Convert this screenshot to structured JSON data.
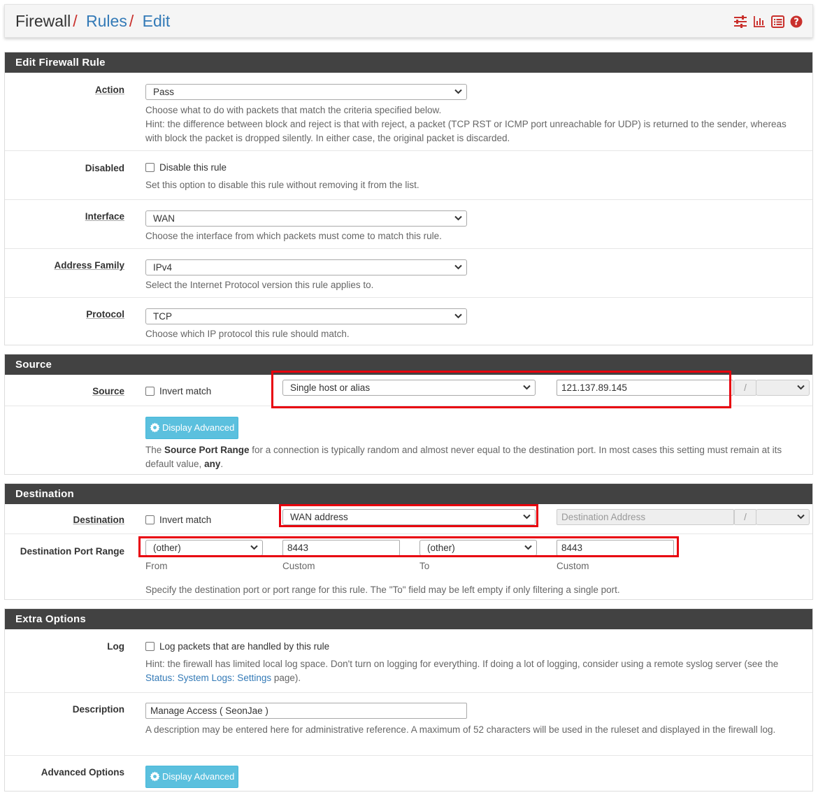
{
  "breadcrumb": {
    "firewall": "Firewall",
    "sep": "/",
    "rules": "Rules",
    "edit": "Edit"
  },
  "toolbar_icons": [
    "sliders-icon",
    "bar-chart-icon",
    "list-icon",
    "help-icon"
  ],
  "colors": {
    "accent_red": "#c9302c",
    "panel_head": "#424242",
    "link": "#337ab7",
    "info_button": "#5bc0de",
    "highlight": "#e8000d"
  },
  "edit_rule": {
    "title": "Edit Firewall Rule",
    "action": {
      "label": "Action",
      "value": "Pass",
      "help1": "Choose what to do with packets that match the criteria specified below.",
      "help2": "Hint: the difference between block and reject is that with reject, a packet (TCP RST or ICMP port unreachable for UDP) is returned to the sender, whereas with block the packet is dropped silently. In either case, the original packet is discarded."
    },
    "disabled": {
      "label": "Disabled",
      "checkbox_label": "Disable this rule",
      "help": "Set this option to disable this rule without removing it from the list."
    },
    "interface": {
      "label": "Interface",
      "value": "WAN",
      "help": "Choose the interface from which packets must come to match this rule."
    },
    "address_family": {
      "label": "Address Family",
      "value": "IPv4",
      "help": "Select the Internet Protocol version this rule applies to."
    },
    "protocol": {
      "label": "Protocol",
      "value": "TCP",
      "help": "Choose which IP protocol this rule should match."
    }
  },
  "source": {
    "title": "Source",
    "label": "Source",
    "invert_label": "Invert match",
    "type": "Single host or alias",
    "address": "121.137.89.145",
    "slash": "/",
    "advanced_button": "Display Advanced",
    "help_pre": "The ",
    "help_bold": "Source Port Range",
    "help_mid": " for a connection is typically random and almost never equal to the destination port. In most cases this setting must remain at its default value, ",
    "help_any": "any",
    "help_end": "."
  },
  "destination": {
    "title": "Destination",
    "label": "Destination",
    "invert_label": "Invert match",
    "type": "WAN address",
    "address_placeholder": "Destination Address",
    "slash": "/",
    "port_range": {
      "label": "Destination Port Range",
      "from_select": "(other)",
      "from_custom": "8443",
      "to_select": "(other)",
      "to_custom": "8443",
      "from_label": "From",
      "custom_label": "Custom",
      "to_label": "To",
      "help": "Specify the destination port or port range for this rule. The \"To\" field may be left empty if only filtering a single port."
    }
  },
  "extra": {
    "title": "Extra Options",
    "log": {
      "label": "Log",
      "checkbox_label": "Log packets that are handled by this rule",
      "help_pre": "Hint: the firewall has limited local log space. Don't turn on logging for everything. If doing a lot of logging, consider using a remote syslog server (see the ",
      "help_link": "Status: System Logs: Settings",
      "help_post": " page)."
    },
    "description": {
      "label": "Description",
      "value": "Manage Access ( SeonJae )",
      "help": "A description may be entered here for administrative reference. A maximum of 52 characters will be used in the ruleset and displayed in the firewall log."
    },
    "advanced": {
      "label": "Advanced Options",
      "button": "Display Advanced"
    }
  }
}
